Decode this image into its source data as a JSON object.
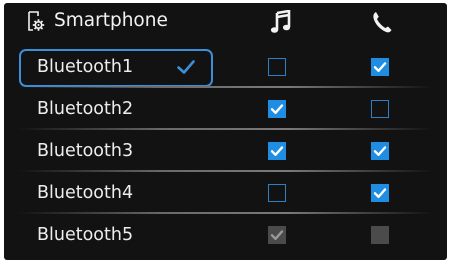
{
  "header": {
    "title": "Smartphone",
    "icons": [
      "smartphone-settings-icon",
      "music-note-icon",
      "phone-icon"
    ]
  },
  "devices": [
    {
      "label": "Bluetooth1",
      "selected": true,
      "music": "unchecked",
      "call": "checked"
    },
    {
      "label": "Bluetooth2",
      "selected": false,
      "music": "checked",
      "call": "unchecked"
    },
    {
      "label": "Bluetooth3",
      "selected": false,
      "music": "checked",
      "call": "checked"
    },
    {
      "label": "Bluetooth4",
      "selected": false,
      "music": "unchecked",
      "call": "checked"
    },
    {
      "label": "Bluetooth5",
      "selected": false,
      "music": "disabled-checked",
      "call": "disabled-unchecked"
    }
  ],
  "colors": {
    "background": "#121212",
    "accent": "#1f8de2",
    "selection": "#3d8ed8",
    "disabled": "#4b4b4b",
    "text": "#ededed"
  }
}
